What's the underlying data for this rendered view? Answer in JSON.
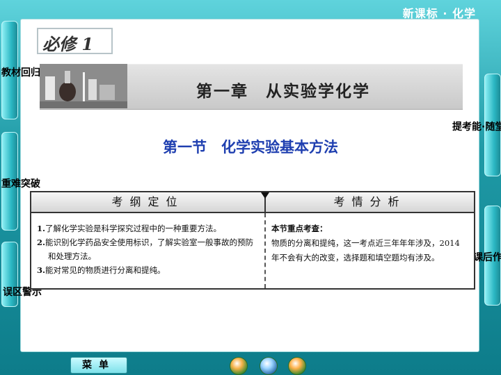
{
  "header": {
    "series": "新课标 · 化学"
  },
  "sidebar_left": [
    {
      "label": "教材回归"
    },
    {
      "label": "重难突破"
    },
    {
      "label": "误区警示"
    }
  ],
  "sidebar_right": [
    {
      "label": "提考能·随堂"
    },
    {
      "label": "课后作业"
    }
  ],
  "book_tag": "必修 1",
  "chapter": {
    "title": "第一章　从实验学化学"
  },
  "section": {
    "title": "第一节　化学实验基本方法"
  },
  "table": {
    "left_header": "考纲定位",
    "right_header": "考情分析",
    "requirements": [
      {
        "num": "1.",
        "text": "了解化学实验是科学探究过程中的一种重要方法。"
      },
      {
        "num": "2.",
        "text": "能识别化学药品安全使用标识，了解实验室一般事故的预防和处理方法。"
      },
      {
        "num": "3.",
        "text": "能对常见的物质进行分离和提纯。"
      }
    ],
    "analysis_head": "本节重点考查：",
    "analysis_text": "物质的分离和提纯，这一考点近三年年年涉及，2014 年不会有大的改变，选择题和填空题均有涉及。"
  },
  "footer": {
    "menu_label": "菜单",
    "nav_icons": [
      "home-icon",
      "back-icon",
      "forward-icon"
    ]
  },
  "colors": {
    "accent": "#1f3fb0",
    "frame": "#2a9aa6"
  }
}
